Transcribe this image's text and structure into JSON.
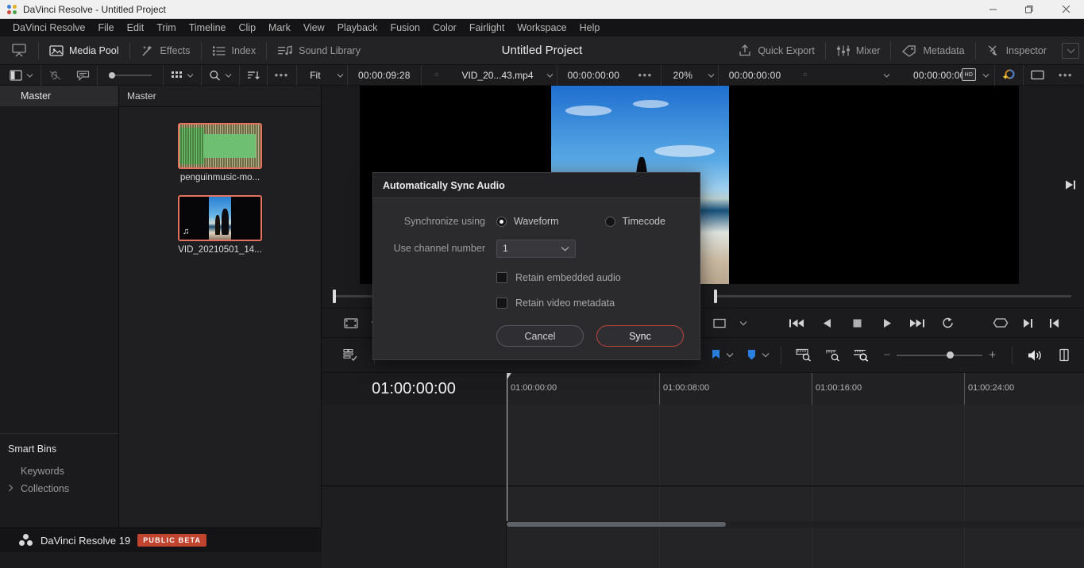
{
  "window": {
    "title": "DaVinci Resolve - Untitled Project",
    "controls": {
      "minimize": "minimize-icon",
      "maximize": "maximize-icon",
      "close": "close-icon"
    }
  },
  "menubar": {
    "items": [
      "DaVinci Resolve",
      "File",
      "Edit",
      "Trim",
      "Timeline",
      "Clip",
      "Mark",
      "View",
      "Playback",
      "Fusion",
      "Color",
      "Fairlight",
      "Workspace",
      "Help"
    ]
  },
  "toolbar": {
    "project_title": "Untitled Project",
    "left_items": [
      {
        "label": "Media Pool",
        "icon": "media-pool-icon",
        "active": true
      },
      {
        "label": "Effects",
        "icon": "effects-wand-icon",
        "active": false
      },
      {
        "label": "Index",
        "icon": "index-list-icon",
        "active": false
      },
      {
        "label": "Sound Library",
        "icon": "sound-library-icon",
        "active": false
      }
    ],
    "right_items": [
      {
        "label": "Quick Export",
        "icon": "upload-icon"
      },
      {
        "label": "Mixer",
        "icon": "mixer-faders-icon"
      },
      {
        "label": "Metadata",
        "icon": "metadata-tag-icon"
      },
      {
        "label": "Inspector",
        "icon": "inspector-brush-icon"
      }
    ],
    "viewer_toggle_icon": "viewer-toggle-icon"
  },
  "subbar": {
    "panel_layout_icon": "panel-layout-icon",
    "link_icon": "unlink-clips-icon",
    "comment_icon": "annotation-icon",
    "thumb_slider_value": "small",
    "view_grid_icon": "thumbnail-view-icon",
    "search_icon": "search-icon",
    "sort_icon": "sort-order-icon",
    "more_icon": "more-options-icon",
    "zoom_fit": "Fit",
    "source_timecode": "00:00:09:28",
    "source_clip_name": "VID_20...43.mp4",
    "record_timecode": "00:00:00:00",
    "timeline_zoom": "20%",
    "timeline_timecode": "00:00:00:00",
    "right_timecode": "00:00:00:00",
    "hd_badge": "HD",
    "color_icon": "color-fx-icon",
    "fullscreen_icon": "fullscreen-icon",
    "overflow_icon": "overflow-menu-icon"
  },
  "bintree": {
    "master_label": "Master",
    "smart_bins_label": "Smart Bins",
    "items": [
      {
        "label": "Keywords",
        "expandable": false
      },
      {
        "label": "Collections",
        "expandable": true
      }
    ]
  },
  "media_pool": {
    "header": "Master",
    "clips": [
      {
        "name": "penguinmusic-mo...",
        "type": "audio",
        "selected": true
      },
      {
        "name": "VID_20210501_14...",
        "type": "video",
        "selected": true
      }
    ]
  },
  "viewer": {
    "prev_icon": "skip-to-start-icon",
    "next_icon": "skip-to-end-icon"
  },
  "transport": {
    "frame_icon": "source-viewer-icon",
    "chevron_icon": "chevron-down-icon",
    "buttons": [
      "jump-to-start-icon",
      "play-reverse-icon",
      "stop-icon",
      "play-forward-icon",
      "jump-to-end-icon",
      "loop-icon"
    ],
    "right_buttons": [
      "inout-range-icon",
      "mark-out-icon",
      "mark-in-icon"
    ]
  },
  "editbar": {
    "timeline_view_icon": "timeline-view-options-icon",
    "flag_icon": "flag-icon",
    "marker_icon": "marker-icon",
    "zoom_fit_icon": "zoom-fit-timeline-icon",
    "zoom_detail_icon": "zoom-detail-icon",
    "zoom_full_icon": "zoom-full-icon",
    "zoom_out_label": "−",
    "zoom_in_label": "+",
    "audio_icon": "speaker-icon",
    "split_icon": "split-view-icon"
  },
  "timeline": {
    "current_timecode": "01:00:00:00",
    "ruler_labels": [
      "01:00:00:00",
      "01:00:08:00",
      "01:00:16:00",
      "01:00:24:00"
    ],
    "playhead_timecode": "01:00:00:00"
  },
  "statusbar": {
    "product": "DaVinci Resolve 19",
    "badge": "PUBLIC BETA",
    "pages": [
      {
        "name": "media-page",
        "icon": "media-page-icon",
        "selected": false
      },
      {
        "name": "cut-page",
        "icon": "cut-page-icon",
        "selected": false
      },
      {
        "name": "edit-page",
        "icon": "edit-page-icon",
        "selected": true
      },
      {
        "name": "fusion-page",
        "icon": "fusion-page-icon",
        "selected": false
      },
      {
        "name": "color-page",
        "icon": "color-page-icon",
        "selected": false
      },
      {
        "name": "fairlight-page",
        "icon": "fairlight-page-icon",
        "selected": false
      },
      {
        "name": "deliver-page",
        "icon": "deliver-page-icon",
        "selected": false
      }
    ],
    "home_icon": "home-icon",
    "settings_icon": "settings-gear-icon"
  },
  "dialog": {
    "title": "Automatically Sync Audio",
    "sync_label": "Synchronize using",
    "options": [
      {
        "label": "Waveform",
        "selected": true
      },
      {
        "label": "Timecode",
        "selected": false
      }
    ],
    "channel_label": "Use channel number",
    "channel_value": "1",
    "checkboxes": [
      {
        "label": "Retain embedded audio",
        "checked": false
      },
      {
        "label": "Retain video metadata",
        "checked": false
      }
    ],
    "cancel_label": "Cancel",
    "confirm_label": "Sync",
    "accent_color": "#c0453a"
  }
}
